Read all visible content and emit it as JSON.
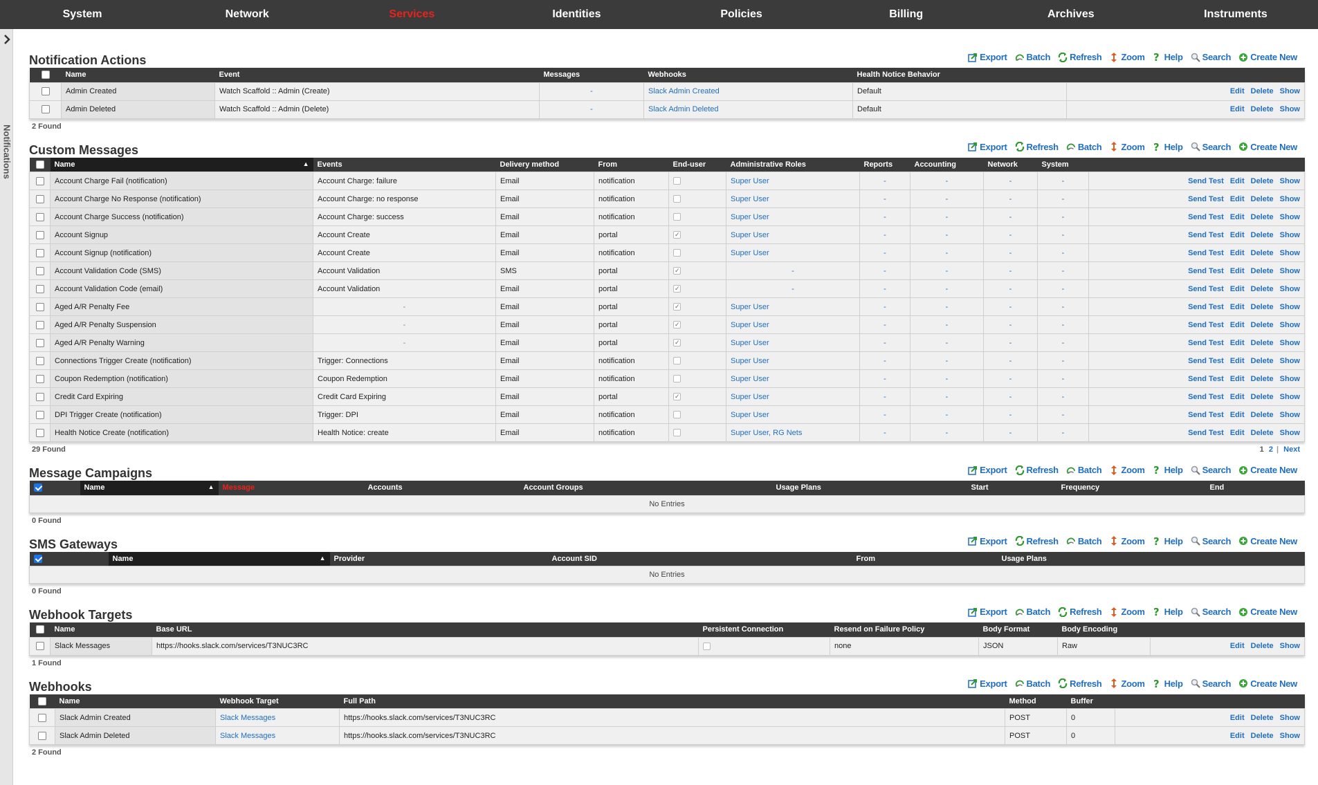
{
  "nav": {
    "items": [
      "System",
      "Network",
      "Services",
      "Identities",
      "Policies",
      "Billing",
      "Archives",
      "Instruments"
    ],
    "active": "Services"
  },
  "drawer": {
    "label": "Notifications"
  },
  "toolbar_labels": {
    "export": "Export",
    "batch": "Batch",
    "refresh": "Refresh",
    "zoom": "Zoom",
    "help": "Help",
    "search": "Search",
    "create": "Create New"
  },
  "row_actions": {
    "send_test": "Send Test",
    "edit": "Edit",
    "delete": "Delete",
    "show": "Show"
  },
  "notification_actions": {
    "title": "Notification Actions",
    "columns": [
      "Name",
      "Event",
      "Messages",
      "Webhooks",
      "Health Notice Behavior"
    ],
    "rows": [
      {
        "name": "Admin Created",
        "event": "Watch Scaffold :: Admin (Create)",
        "messages": "-",
        "webhooks": "Slack Admin Created",
        "behavior": "Default"
      },
      {
        "name": "Admin Deleted",
        "event": "Watch Scaffold :: Admin (Delete)",
        "messages": "-",
        "webhooks": "Slack Admin Deleted",
        "behavior": "Default"
      }
    ],
    "found": "2 Found"
  },
  "custom_messages": {
    "title": "Custom Messages",
    "columns": [
      "Name",
      "Events",
      "Delivery method",
      "From",
      "End-user",
      "Administrative Roles",
      "Reports",
      "Accounting",
      "Network",
      "System"
    ],
    "rows": [
      {
        "name": "Account Charge Fail (notification)",
        "events": "Account Charge: failure",
        "delivery": "Email",
        "from": "notification",
        "enduser": false,
        "roles": "Super User",
        "reports": "-",
        "accounting": "-",
        "network": "-",
        "system": "-"
      },
      {
        "name": "Account Charge No Response (notification)",
        "events": "Account Charge: no response",
        "delivery": "Email",
        "from": "notification",
        "enduser": false,
        "roles": "Super User",
        "reports": "-",
        "accounting": "-",
        "network": "-",
        "system": "-"
      },
      {
        "name": "Account Charge Success (notification)",
        "events": "Account Charge: success",
        "delivery": "Email",
        "from": "notification",
        "enduser": false,
        "roles": "Super User",
        "reports": "-",
        "accounting": "-",
        "network": "-",
        "system": "-"
      },
      {
        "name": "Account Signup",
        "events": "Account Create",
        "delivery": "Email",
        "from": "portal",
        "enduser": true,
        "roles": "Super User",
        "reports": "-",
        "accounting": "-",
        "network": "-",
        "system": "-"
      },
      {
        "name": "Account Signup (notification)",
        "events": "Account Create",
        "delivery": "Email",
        "from": "notification",
        "enduser": false,
        "roles": "Super User",
        "reports": "-",
        "accounting": "-",
        "network": "-",
        "system": "-"
      },
      {
        "name": "Account Validation Code (SMS)",
        "events": "Account Validation",
        "delivery": "SMS",
        "from": "portal",
        "enduser": true,
        "roles": "-",
        "reports": "-",
        "accounting": "-",
        "network": "-",
        "system": "-"
      },
      {
        "name": "Account Validation Code (email)",
        "events": "Account Validation",
        "delivery": "Email",
        "from": "portal",
        "enduser": true,
        "roles": "-",
        "reports": "-",
        "accounting": "-",
        "network": "-",
        "system": "-"
      },
      {
        "name": "Aged A/R Penalty Fee",
        "events": "-",
        "delivery": "Email",
        "from": "portal",
        "enduser": true,
        "roles": "Super User",
        "reports": "-",
        "accounting": "-",
        "network": "-",
        "system": "-"
      },
      {
        "name": "Aged A/R Penalty Suspension",
        "events": "-",
        "delivery": "Email",
        "from": "portal",
        "enduser": true,
        "roles": "Super User",
        "reports": "-",
        "accounting": "-",
        "network": "-",
        "system": "-"
      },
      {
        "name": "Aged A/R Penalty Warning",
        "events": "-",
        "delivery": "Email",
        "from": "portal",
        "enduser": true,
        "roles": "Super User",
        "reports": "-",
        "accounting": "-",
        "network": "-",
        "system": "-"
      },
      {
        "name": "Connections Trigger Create (notification)",
        "events": "Trigger: Connections",
        "delivery": "Email",
        "from": "notification",
        "enduser": false,
        "roles": "Super User",
        "reports": "-",
        "accounting": "-",
        "network": "-",
        "system": "-"
      },
      {
        "name": "Coupon Redemption (notification)",
        "events": "Coupon Redemption",
        "delivery": "Email",
        "from": "notification",
        "enduser": false,
        "roles": "Super User",
        "reports": "-",
        "accounting": "-",
        "network": "-",
        "system": "-"
      },
      {
        "name": "Credit Card Expiring",
        "events": "Credit Card Expiring",
        "delivery": "Email",
        "from": "portal",
        "enduser": true,
        "roles": "Super User",
        "reports": "-",
        "accounting": "-",
        "network": "-",
        "system": "-"
      },
      {
        "name": "DPI Trigger Create (notification)",
        "events": "Trigger: DPI",
        "delivery": "Email",
        "from": "notification",
        "enduser": false,
        "roles": "Super User",
        "reports": "-",
        "accounting": "-",
        "network": "-",
        "system": "-"
      },
      {
        "name": "Health Notice Create (notification)",
        "events": "Health Notice: create",
        "delivery": "Email",
        "from": "notification",
        "enduser": false,
        "roles": "Super User, RG Nets",
        "reports": "-",
        "accounting": "-",
        "network": "-",
        "system": "-"
      }
    ],
    "found": "29 Found",
    "pages": [
      "1",
      "2"
    ],
    "next": "Next"
  },
  "message_campaigns": {
    "title": "Message Campaigns",
    "columns": [
      "Name",
      "Message",
      "Accounts",
      "Account Groups",
      "Usage Plans",
      "Start",
      "Frequency",
      "End"
    ],
    "empty": "No Entries",
    "found": "0 Found"
  },
  "sms_gateways": {
    "title": "SMS Gateways",
    "columns": [
      "Name",
      "Provider",
      "Account SID",
      "From",
      "Usage Plans"
    ],
    "empty": "No Entries",
    "found": "0 Found"
  },
  "webhook_targets": {
    "title": "Webhook Targets",
    "columns": [
      "Name",
      "Base URL",
      "Persistent Connection",
      "Resend on Failure Policy",
      "Body Format",
      "Body Encoding"
    ],
    "rows": [
      {
        "name": "Slack Messages",
        "base_url": "https://hooks.slack.com/services/T3NUC3RC",
        "persistent": false,
        "resend": "none",
        "format": "JSON",
        "encoding": "Raw"
      }
    ],
    "found": "1 Found"
  },
  "webhooks": {
    "title": "Webhooks",
    "columns": [
      "Name",
      "Webhook Target",
      "Full Path",
      "Method",
      "Buffer"
    ],
    "rows": [
      {
        "name": "Slack Admin Created",
        "target": "Slack Messages",
        "path": "https://hooks.slack.com/services/T3NUC3RC",
        "method": "POST",
        "buffer": "0"
      },
      {
        "name": "Slack Admin Deleted",
        "target": "Slack Messages",
        "path": "https://hooks.slack.com/services/T3NUC3RC",
        "method": "POST",
        "buffer": "0"
      }
    ],
    "found": "2 Found"
  }
}
